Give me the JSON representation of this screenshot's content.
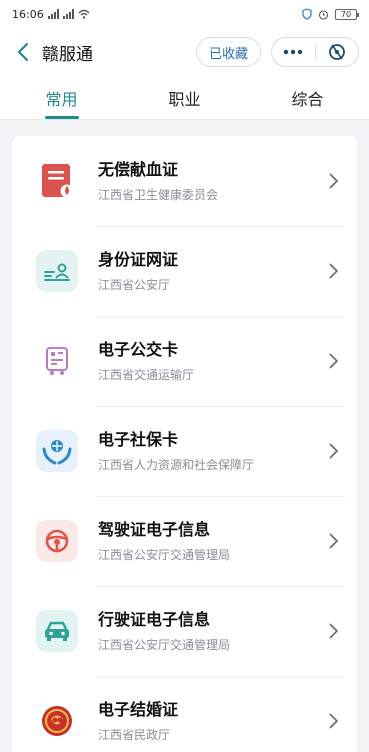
{
  "status_bar": {
    "time": "16:06",
    "signal_1": "4G",
    "signal_2": "4G",
    "battery": "70"
  },
  "nav": {
    "title": "赣服通",
    "favorite_label": "已收藏",
    "back_icon": "chevron-left-icon",
    "more_icon": "more-dots-icon",
    "close_icon": "close-circle-icon"
  },
  "tabs": [
    {
      "label": "常用",
      "active": true
    },
    {
      "label": "职业",
      "active": false
    },
    {
      "label": "综合",
      "active": false
    }
  ],
  "accent_color": "#1f8a8e",
  "items": [
    {
      "title": "无偿献血证",
      "subtitle": "江西省卫生健康委员会",
      "icon": "blood-donation-icon"
    },
    {
      "title": "身份证网证",
      "subtitle": "江西省公安厅",
      "icon": "id-card-icon"
    },
    {
      "title": "电子公交卡",
      "subtitle": "江西省交通运输厅",
      "icon": "bus-card-icon"
    },
    {
      "title": "电子社保卡",
      "subtitle": "江西省人力资源和社会保障厅",
      "icon": "social-security-icon"
    },
    {
      "title": "驾驶证电子信息",
      "subtitle": "江西省公安厅交通管理局",
      "icon": "steering-wheel-icon"
    },
    {
      "title": "行驶证电子信息",
      "subtitle": "江西省公安厅交通管理局",
      "icon": "car-icon"
    },
    {
      "title": "电子结婚证",
      "subtitle": "江西省民政厅",
      "icon": "marriage-emblem-icon"
    }
  ]
}
